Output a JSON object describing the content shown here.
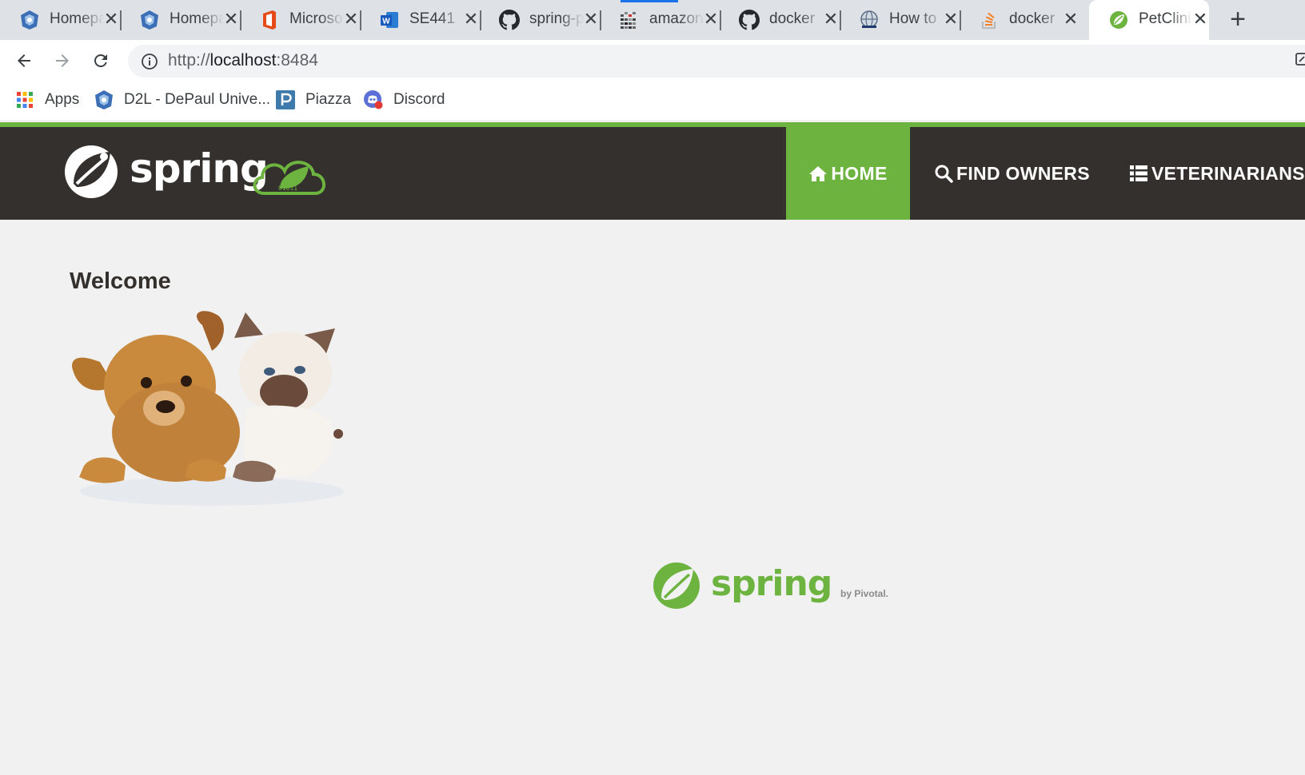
{
  "browser": {
    "tabs": [
      {
        "title": "Homepage",
        "icon": "d2l-icon",
        "active": false
      },
      {
        "title": "Homepage",
        "icon": "d2l-icon",
        "active": false
      },
      {
        "title": "Microsoft Office",
        "icon": "office-icon",
        "active": false
      },
      {
        "title": "SE441",
        "icon": "word-icon",
        "active": false
      },
      {
        "title": "spring-petclinic",
        "icon": "github-icon",
        "active": false
      },
      {
        "title": "amazon",
        "icon": "aws-icon",
        "active": false,
        "loading": true
      },
      {
        "title": "docker",
        "icon": "github-icon",
        "active": false
      },
      {
        "title": "How to",
        "icon": "globe-icon",
        "active": false
      },
      {
        "title": "docker",
        "icon": "stackoverflow-icon",
        "active": false
      },
      {
        "title": "PetClinic",
        "icon": "spring-leaf-icon",
        "active": true
      }
    ],
    "new_tab_symbol": "+",
    "close_symbol": "✕",
    "url": {
      "prefix": "http://",
      "host": "localhost",
      "port": ":8484"
    },
    "bookmarks": [
      {
        "label": "Apps",
        "icon": "apps-grid-icon"
      },
      {
        "label": "D2L - DePaul Unive...",
        "icon": "d2l-icon"
      },
      {
        "label": "Piazza",
        "icon": "piazza-icon"
      },
      {
        "label": "Discord",
        "icon": "discord-icon"
      }
    ]
  },
  "app": {
    "brand": "spring",
    "nav": [
      {
        "label": "HOME",
        "icon": "home-icon",
        "active": true
      },
      {
        "label": "FIND OWNERS",
        "icon": "search-icon",
        "active": false
      },
      {
        "label": "VETERINARIANS",
        "icon": "list-icon",
        "active": false
      }
    ],
    "welcome": "Welcome",
    "footer": {
      "brand": "spring",
      "by": "by Pivotal."
    }
  },
  "colors": {
    "spring_green": "#6db33f",
    "navbar_bg": "#34302d",
    "page_bg": "#f1f1f1",
    "tabstrip_bg": "#dee1e6"
  }
}
